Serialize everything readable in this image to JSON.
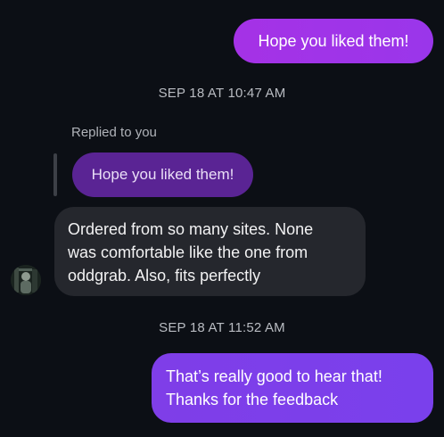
{
  "messages": {
    "sent_top": "Hope you liked them!",
    "timestamp_1": "SEP 18 AT 10:47 AM",
    "replied_label": "Replied to you",
    "quoted": "Hope you liked them!",
    "received_lines": [
      "Ordered from so many sites. None",
      "was comfortable like the one from",
      "oddgrab. Also, fits perfectly"
    ],
    "timestamp_2": "SEP 18 AT 11:52 AM",
    "sent_bottom_lines": [
      "That’s really good to hear that!",
      "Thanks for the feedback"
    ]
  },
  "colors": {
    "background": "#0c0f15",
    "sent_bubble": "#a532e6",
    "sent_bubble_latest": "#7f3ee8",
    "reply_quote": "#5a2494",
    "received_bubble": "#25272d"
  },
  "icons": {
    "avatar": "profile-photo"
  }
}
